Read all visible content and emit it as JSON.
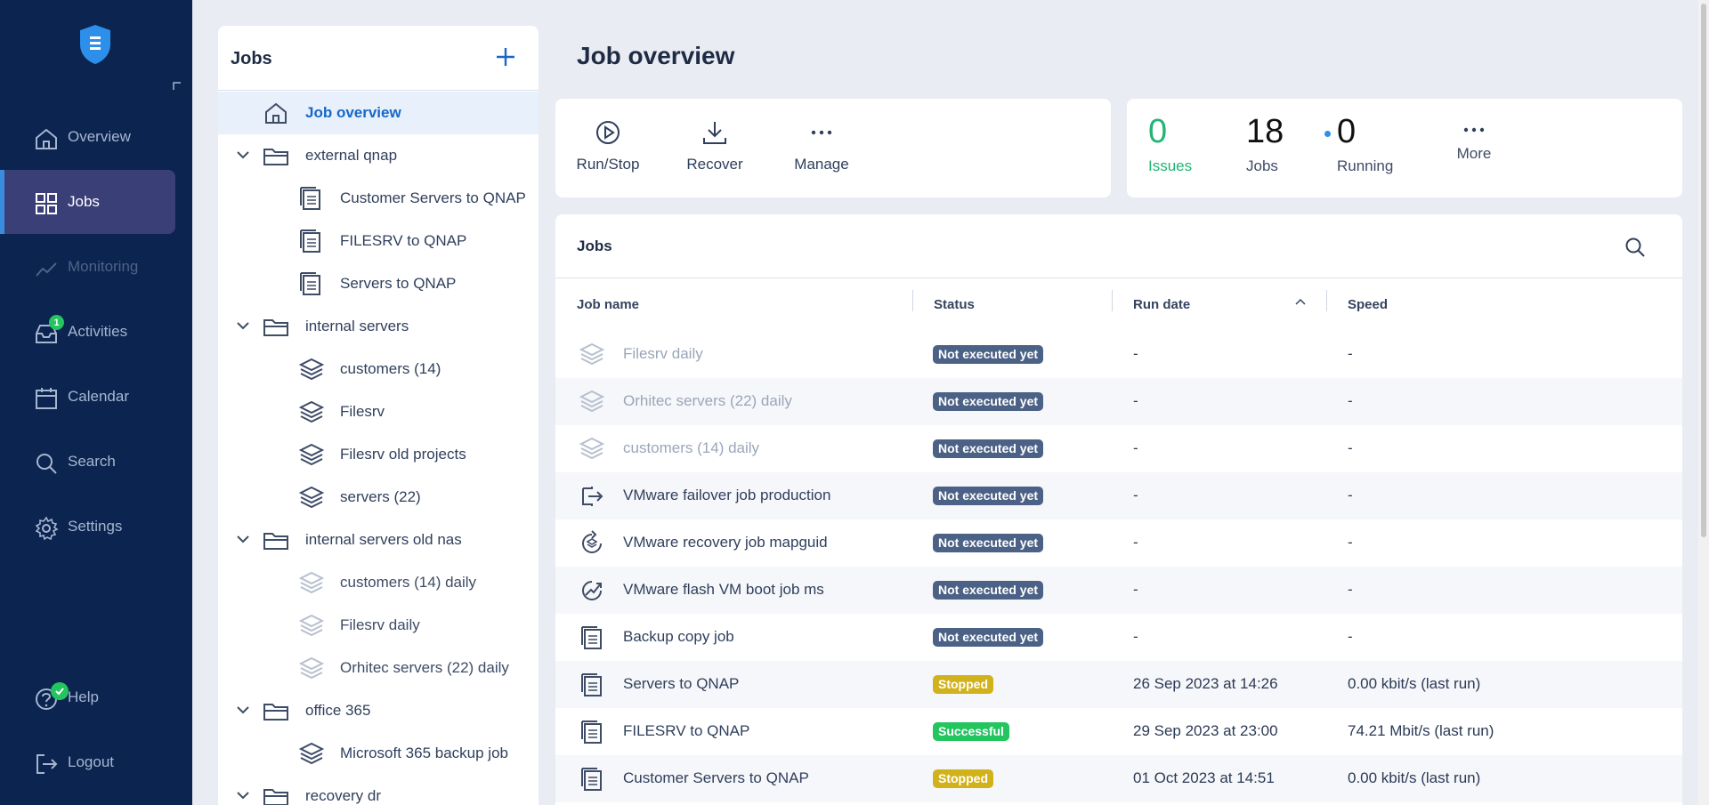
{
  "sidebar": {
    "items": [
      {
        "label": "Overview",
        "icon": "home-icon"
      },
      {
        "label": "Jobs",
        "icon": "grid-icon"
      },
      {
        "label": "Monitoring",
        "icon": "chart-line-icon"
      },
      {
        "label": "Activities",
        "icon": "inbox-icon",
        "badge": "1"
      },
      {
        "label": "Calendar",
        "icon": "calendar-icon"
      },
      {
        "label": "Search",
        "icon": "search-icon"
      },
      {
        "label": "Settings",
        "icon": "gear-icon"
      }
    ],
    "bottom": [
      {
        "label": "Help",
        "icon": "help-icon"
      },
      {
        "label": "Logout",
        "icon": "logout-icon"
      }
    ]
  },
  "tree": {
    "title": "Jobs",
    "nodes": [
      {
        "label": "Job overview"
      },
      {
        "label": "external qnap"
      },
      {
        "label": "Customer Servers to QNAP"
      },
      {
        "label": "FILESRV to QNAP"
      },
      {
        "label": "Servers to QNAP"
      },
      {
        "label": "internal servers"
      },
      {
        "label": "customers (14)"
      },
      {
        "label": "Filesrv"
      },
      {
        "label": "Filesrv old projects"
      },
      {
        "label": "servers (22)"
      },
      {
        "label": "internal servers old nas"
      },
      {
        "label": "customers (14) daily"
      },
      {
        "label": "Filesrv daily"
      },
      {
        "label": "Orhitec servers (22) daily"
      },
      {
        "label": "office 365"
      },
      {
        "label": "Microsoft 365 backup job"
      },
      {
        "label": "recovery dr"
      }
    ]
  },
  "main": {
    "title": "Job overview",
    "actions": {
      "run_stop": "Run/Stop",
      "recover": "Recover",
      "manage": "Manage"
    },
    "stats": {
      "issues": {
        "value": "0",
        "label": "Issues"
      },
      "jobs": {
        "value": "18",
        "label": "Jobs"
      },
      "running": {
        "value": "0",
        "label": "Running"
      },
      "more": "More"
    },
    "jobs": {
      "title": "Jobs",
      "columns": {
        "name": "Job name",
        "status": "Status",
        "run_date": "Run date",
        "speed": "Speed"
      },
      "rows": [
        {
          "name": "Filesrv daily",
          "status": "Not executed yet",
          "run_date": "-",
          "speed": "-"
        },
        {
          "name": "Orhitec servers (22) daily",
          "status": "Not executed yet",
          "run_date": "-",
          "speed": "-"
        },
        {
          "name": "customers (14) daily",
          "status": "Not executed yet",
          "run_date": "-",
          "speed": "-"
        },
        {
          "name": "VMware failover job production",
          "status": "Not executed yet",
          "run_date": "-",
          "speed": "-"
        },
        {
          "name": "VMware recovery job mapguid",
          "status": "Not executed yet",
          "run_date": "-",
          "speed": "-"
        },
        {
          "name": "VMware flash VM boot job ms",
          "status": "Not executed yet",
          "run_date": "-",
          "speed": "-"
        },
        {
          "name": "Backup copy job",
          "status": "Not executed yet",
          "run_date": "-",
          "speed": "-"
        },
        {
          "name": "Servers to QNAP",
          "status": "Stopped",
          "run_date": "26 Sep 2023 at 14:26",
          "speed": "0.00 kbit/s (last run)"
        },
        {
          "name": "FILESRV to QNAP",
          "status": "Successful",
          "run_date": "29 Sep 2023 at 23:00",
          "speed": "74.21 Mbit/s (last run)"
        },
        {
          "name": "Customer Servers to QNAP",
          "status": "Stopped",
          "run_date": "01 Oct 2023 at 14:51",
          "speed": "0.00 kbit/s (last run)"
        }
      ]
    }
  },
  "colors": {
    "sidebar_bg": "#0b2450",
    "active_nav": "#3b3f77",
    "accent": "#1668c8",
    "status_not_executed": "#4b6186",
    "status_stopped": "#d2b21b",
    "status_successful": "#22c55e"
  }
}
